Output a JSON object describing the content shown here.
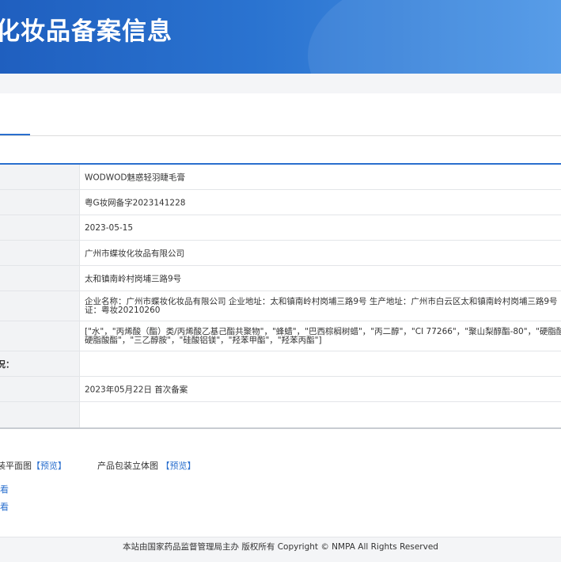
{
  "header": {
    "title": "化妆品备案信息"
  },
  "rows": [
    {
      "label": "",
      "value": "WODWOD魅惑轻羽睫毛膏"
    },
    {
      "label": "",
      "value": "粤G妆网备字2023141228"
    },
    {
      "label": "",
      "value": "2023-05-15"
    },
    {
      "label": "",
      "value": "广州市蝶妆化妆品有限公司"
    },
    {
      "label": "",
      "value": "太和镇南岭村岗埔三路9号"
    },
    {
      "label": "",
      "value_lines": [
        "企业名称：广州市蝶妆化妆品有限公司 企业地址：太和镇南岭村岗埔三路9号 生产地址：广州市白云区太和镇南岭村岗埔三路9号",
        "证：粤妆20210260"
      ]
    },
    {
      "label": "",
      "value_lines": [
        "[\"水\"，\"丙烯酸（酯）类/丙烯酸乙基己酯共聚物\"，\"蜂蜡\"，\"巴西棕榈树蜡\"，\"丙二醇\"，\"CI 77266\"，\"聚山梨醇酯-80\"，\"硬脂酸",
        "硬脂酸酯\"，\"三乙醇胺\"，\"硅酸铝镁\"，\"羟苯甲酯\"，\"羟苯丙酯\"]"
      ]
    },
    {
      "label": "况：",
      "value": ""
    },
    {
      "label": "",
      "value": "2023年05月22日 首次备案"
    },
    {
      "label": "",
      "value": ""
    }
  ],
  "documents": {
    "item1_label": "装平面图",
    "item1_link": "【预览】",
    "item2_label": "产品包装立体图",
    "item2_link": "【预览】",
    "view_link_1": "看",
    "view_link_2": "看"
  },
  "footer": {
    "text": "本站由国家药品监督管理局主办 版权所有 Copyright © NMPA All Rights Reserved"
  },
  "colors": {
    "header": "#2a73d0",
    "accent": "#2a6fce",
    "label_bg": "#f2f3f5"
  }
}
